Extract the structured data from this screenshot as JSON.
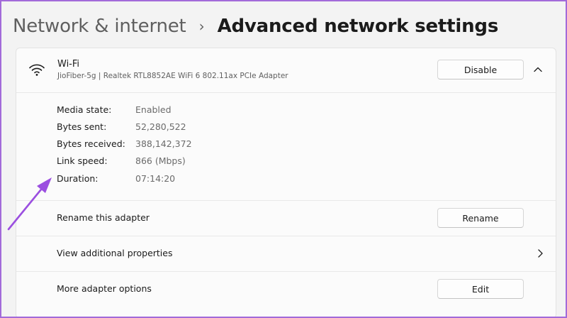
{
  "breadcrumb": {
    "parent": "Network & internet",
    "separator": "›",
    "current": "Advanced network settings"
  },
  "adapter": {
    "icon": "wifi-icon",
    "name": "Wi-Fi",
    "description": "JioFiber-5g | Realtek RTL8852AE WiFi 6 802.11ax PCIe Adapter",
    "disable_label": "Disable",
    "expand_icon": "chevron-up-icon"
  },
  "properties": [
    {
      "label": "Media state:",
      "value": "Enabled"
    },
    {
      "label": "Bytes sent:",
      "value": "52,280,522"
    },
    {
      "label": "Bytes received:",
      "value": "388,142,372"
    },
    {
      "label": "Link speed:",
      "value": "866 (Mbps)"
    },
    {
      "label": "Duration:",
      "value": "07:14:20"
    }
  ],
  "rename": {
    "label": "Rename this adapter",
    "button": "Rename"
  },
  "view_properties": {
    "label": "View additional properties",
    "icon": "chevron-right-icon"
  },
  "more_options": {
    "label": "More adapter options",
    "button": "Edit"
  },
  "colors": {
    "frame_border": "#a26ad9",
    "annotation_arrow": "#9b4fe0",
    "background": "#f3f3f3",
    "card": "#fbfbfb"
  }
}
